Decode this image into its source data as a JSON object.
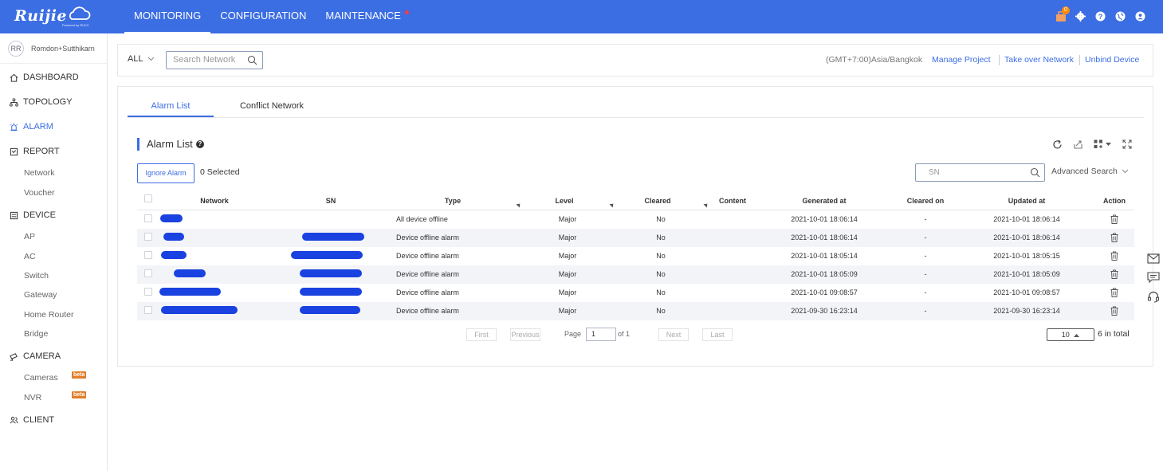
{
  "brand": {
    "logo_text": "Ruijie",
    "logo_sub": "Powered by RUCC"
  },
  "topnav": {
    "items": [
      {
        "label": "MONITORING"
      },
      {
        "label": "CONFIGURATION"
      },
      {
        "label": "MAINTENANCE"
      }
    ],
    "cart_badge": "0"
  },
  "user": {
    "avatar_text": "RR",
    "name": "Romdon+Sutthikarn"
  },
  "sidebar": {
    "items": [
      {
        "label": "DASHBOARD"
      },
      {
        "label": "TOPOLOGY"
      },
      {
        "label": "ALARM"
      },
      {
        "label": "REPORT"
      },
      {
        "label": "DEVICE"
      },
      {
        "label": "CAMERA"
      },
      {
        "label": "CLIENT"
      }
    ],
    "report_sub": [
      "Network",
      "Voucher"
    ],
    "device_sub": [
      "AP",
      "AC",
      "Switch",
      "Gateway",
      "Home Router",
      "Bridge"
    ],
    "camera_sub": [
      "Cameras",
      "NVR"
    ],
    "beta_label": "beta"
  },
  "filter": {
    "scope": "ALL",
    "search_placeholder": "Search Network",
    "timezone": "(GMT+7:00)Asia/Bangkok",
    "links": [
      "Manage Project",
      "Take over Network",
      "Unbind Device"
    ]
  },
  "tabs": [
    "Alarm List",
    "Conflict Network"
  ],
  "section": {
    "title": "Alarm List",
    "help": "?"
  },
  "actions": {
    "ignore_label": "Ignore Alarm",
    "selected": "0 Selected",
    "sn_placeholder": "SN",
    "advanced": "Advanced Search"
  },
  "table": {
    "headers": [
      "Network",
      "SN",
      "Type",
      "Level",
      "Cleared",
      "Content",
      "Generated at",
      "Cleared on",
      "Updated at",
      "Action"
    ],
    "rows": [
      {
        "type": "All device offline",
        "level": "Major",
        "cleared": "No",
        "generated": "2021-10-01 18:06:14",
        "cleared_on": "-",
        "updated": "2021-10-01 18:06:14"
      },
      {
        "type": "Device offline alarm",
        "level": "Major",
        "cleared": "No",
        "generated": "2021-10-01 18:06:14",
        "cleared_on": "-",
        "updated": "2021-10-01 18:06:14"
      },
      {
        "type": "Device offline alarm",
        "level": "Major",
        "cleared": "No",
        "generated": "2021-10-01 18:05:14",
        "cleared_on": "-",
        "updated": "2021-10-01 18:05:15"
      },
      {
        "type": "Device offline alarm",
        "level": "Major",
        "cleared": "No",
        "generated": "2021-10-01 18:05:09",
        "cleared_on": "-",
        "updated": "2021-10-01 18:05:09"
      },
      {
        "type": "Device offline alarm",
        "level": "Major",
        "cleared": "No",
        "generated": "2021-10-01 09:08:57",
        "cleared_on": "-",
        "updated": "2021-10-01 09:08:57"
      },
      {
        "type": "Device offline alarm",
        "level": "Major",
        "cleared": "No",
        "generated": "2021-09-30 16:23:14",
        "cleared_on": "-",
        "updated": "2021-09-30 16:23:14"
      }
    ]
  },
  "pagination": {
    "first": "First",
    "previous": "Previous",
    "page_label": "Page",
    "page": "1",
    "of": "of 1",
    "next": "Next",
    "last": "Last",
    "per_page": "10",
    "total": "6 in total"
  },
  "colors": {
    "primary": "#3b6de3",
    "beta": "#e07d29",
    "redaction": "#1942e0"
  }
}
